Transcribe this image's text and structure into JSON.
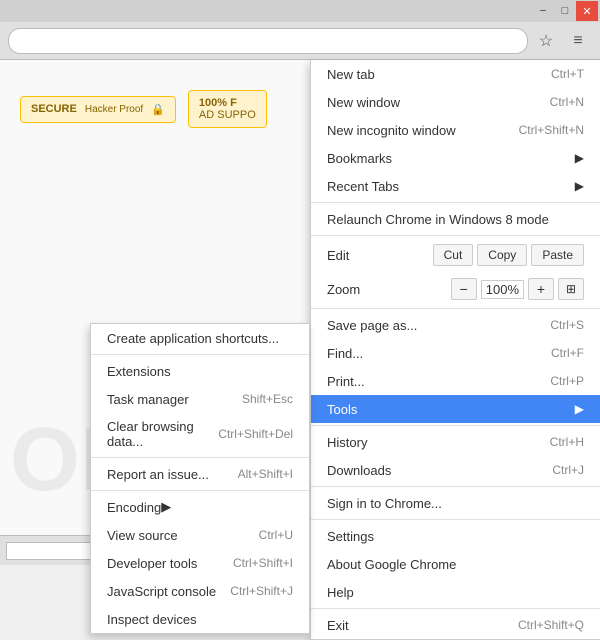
{
  "titlebar": {
    "minimize_label": "−",
    "restore_label": "□",
    "close_label": "✕"
  },
  "toolbar": {
    "bookmark_icon": "☆",
    "menu_icon": "≡"
  },
  "page": {
    "secure_badge": "SECURE",
    "secure_subtitle": "Hacker Proof",
    "ad_badge": "100% F",
    "ad_subtitle": "AD SUPPO",
    "watermark": "OR"
  },
  "status_bar": {
    "dropdown_icon": "▼"
  },
  "main_menu": {
    "items": [
      {
        "label": "New tab",
        "shortcut": "Ctrl+T",
        "arrow": ""
      },
      {
        "label": "New window",
        "shortcut": "Ctrl+N",
        "arrow": ""
      },
      {
        "label": "New incognito window",
        "shortcut": "Ctrl+Shift+N",
        "arrow": ""
      },
      {
        "label": "Bookmarks",
        "shortcut": "",
        "arrow": "▶"
      },
      {
        "label": "Recent Tabs",
        "shortcut": "",
        "arrow": "▶"
      },
      {
        "divider": true
      },
      {
        "label": "Relaunch Chrome in Windows 8 mode",
        "shortcut": "",
        "arrow": ""
      },
      {
        "divider": true
      },
      {
        "label": "Edit",
        "shortcut": "",
        "arrow": "",
        "special": "edit"
      },
      {
        "label": "Zoom",
        "shortcut": "",
        "arrow": "",
        "special": "zoom"
      },
      {
        "divider": true
      },
      {
        "label": "Save page as...",
        "shortcut": "Ctrl+S",
        "arrow": ""
      },
      {
        "label": "Find...",
        "shortcut": "Ctrl+F",
        "arrow": ""
      },
      {
        "label": "Print...",
        "shortcut": "Ctrl+P",
        "arrow": ""
      },
      {
        "label": "Tools",
        "shortcut": "",
        "arrow": "▶",
        "highlighted": true
      },
      {
        "divider": true
      },
      {
        "label": "History",
        "shortcut": "Ctrl+H",
        "arrow": ""
      },
      {
        "label": "Downloads",
        "shortcut": "Ctrl+J",
        "arrow": ""
      },
      {
        "divider": true
      },
      {
        "label": "Sign in to Chrome...",
        "shortcut": "",
        "arrow": ""
      },
      {
        "divider": true
      },
      {
        "label": "Settings",
        "shortcut": "",
        "arrow": ""
      },
      {
        "label": "About Google Chrome",
        "shortcut": "",
        "arrow": ""
      },
      {
        "label": "Help",
        "shortcut": "",
        "arrow": ""
      },
      {
        "divider": true
      },
      {
        "label": "Exit",
        "shortcut": "Ctrl+Shift+Q",
        "arrow": ""
      }
    ],
    "edit_buttons": [
      "Cut",
      "Copy",
      "Paste"
    ],
    "zoom_minus": "−",
    "zoom_value": "100%",
    "zoom_plus": "+",
    "zoom_expand": "⊞"
  },
  "sub_menu": {
    "items": [
      {
        "label": "Create application shortcuts...",
        "shortcut": ""
      },
      {
        "divider": true
      },
      {
        "label": "Extensions",
        "shortcut": ""
      },
      {
        "label": "Task manager",
        "shortcut": "Shift+Esc"
      },
      {
        "label": "Clear browsing data...",
        "shortcut": "Ctrl+Shift+Del"
      },
      {
        "divider": true
      },
      {
        "label": "Report an issue...",
        "shortcut": "Alt+Shift+I"
      },
      {
        "divider": true
      },
      {
        "label": "Encoding",
        "shortcut": "",
        "arrow": "▶"
      },
      {
        "label": "View source",
        "shortcut": "Ctrl+U"
      },
      {
        "label": "Developer tools",
        "shortcut": "Ctrl+Shift+I"
      },
      {
        "label": "JavaScript console",
        "shortcut": "Ctrl+Shift+J"
      },
      {
        "label": "Inspect devices",
        "shortcut": ""
      }
    ]
  }
}
